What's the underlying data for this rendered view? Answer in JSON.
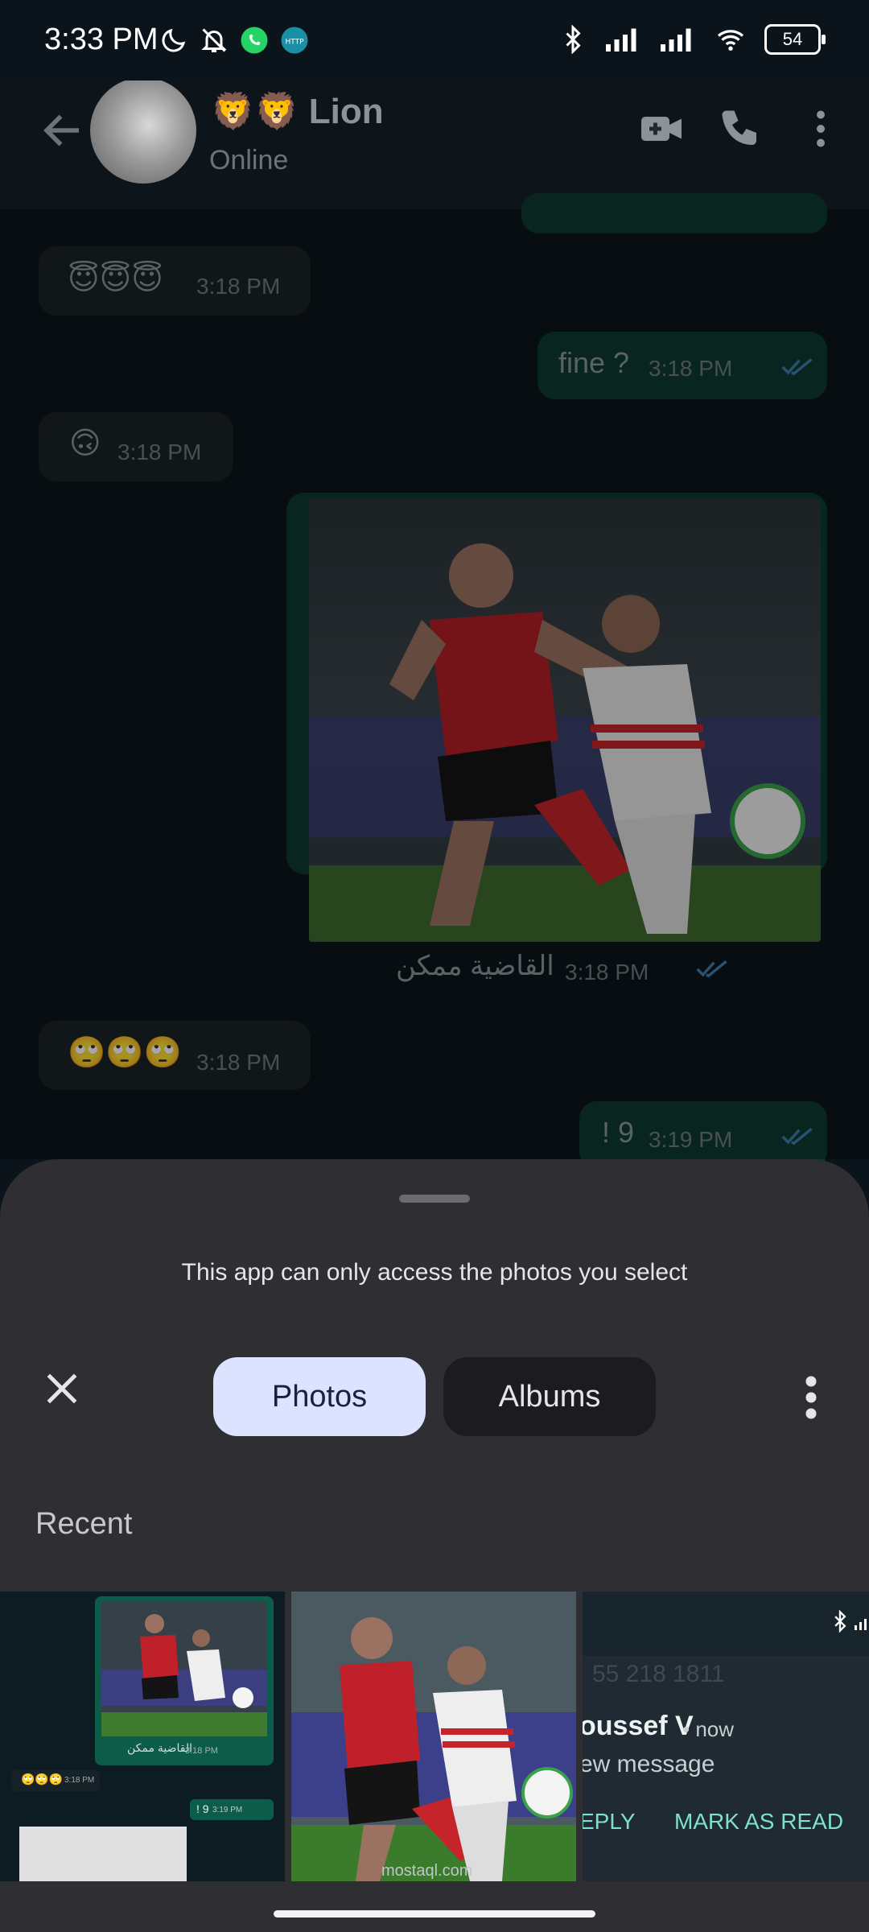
{
  "status_bar": {
    "time": "3:33 PM",
    "left_icons": [
      "moon-icon",
      "bell-off-icon",
      "whatsapp-icon",
      "http-app-icon"
    ],
    "right_icons": [
      "bluetooth-icon",
      "signal-icon",
      "signal-icon",
      "wifi-icon"
    ],
    "battery": "54"
  },
  "header": {
    "contact_name": "🦁🦁 Lion",
    "status": "Online",
    "actions": [
      "video-call-icon",
      "phone-icon",
      "more-vert-icon"
    ]
  },
  "messages": [
    {
      "dir": "in",
      "text": "😇😇😇",
      "time": "3:18 PM"
    },
    {
      "dir": "out",
      "text": "fine ?",
      "time": "3:18 PM"
    },
    {
      "dir": "in",
      "text": "🙃",
      "time": "3:18 PM"
    },
    {
      "dir": "out",
      "type": "image",
      "caption": "القاضية ممكن",
      "time": "3:18 PM"
    },
    {
      "dir": "in",
      "text": "🙄🙄🙄",
      "time": "3:18 PM"
    },
    {
      "dir": "out",
      "text": "! 9",
      "time": "3:19 PM"
    }
  ],
  "picker": {
    "message": "This app can only access the photos you select",
    "tabs": {
      "photos": "Photos",
      "albums": "Albums"
    },
    "section": "Recent",
    "thumb1": {
      "caption": "القاضية ممكن",
      "time1": "3:18 PM",
      "time2": "3:19 PM",
      "text": "! 9"
    },
    "thumb2": {
      "watermark": "mostaql.com"
    },
    "thumb3": {
      "number": "55 218 1811",
      "sender": "oussef V",
      "when": "• now",
      "preview": "ew message",
      "reply": "EPLY",
      "mark_read": "MARK AS READ"
    }
  },
  "colors": {
    "chat_bg": "#0b141a",
    "incoming_bubble": "#1b2226",
    "outgoing_bubble": "#0d3a30",
    "sheet_bg": "#2e2e33",
    "selected_tab": "#dce3ff",
    "notification_accent": "#7fe0d0"
  }
}
